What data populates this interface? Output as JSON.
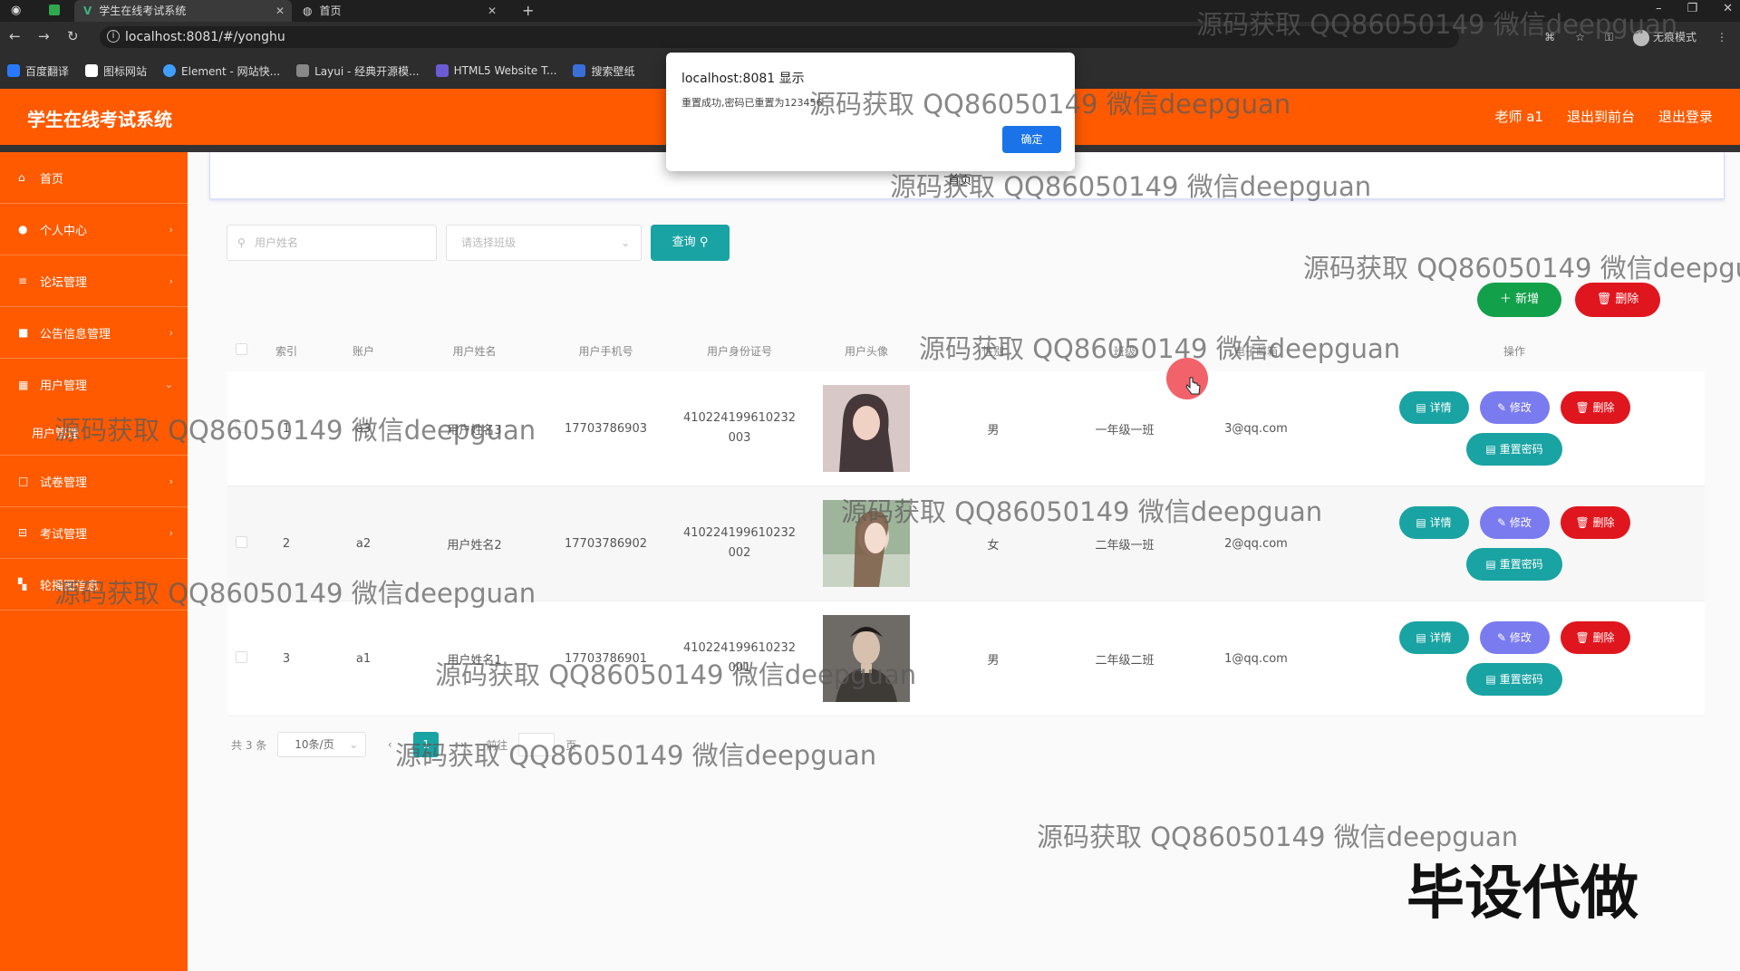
{
  "browser": {
    "tabs": [
      {
        "title": "学生在线考试系统"
      },
      {
        "title": "首页"
      }
    ],
    "url": "localhost:8081/#/yonghu",
    "incognito": "无痕模式",
    "bookmarks": [
      "百度翻译",
      "图标网站",
      "Element - 网站快...",
      "Layui - 经典开源模...",
      "HTML5 Website T...",
      "搜索壁纸"
    ]
  },
  "header": {
    "title": "学生在线考试系统",
    "links": [
      "老师 a1",
      "退出到前台",
      "退出登录"
    ]
  },
  "sidebar": {
    "items": [
      {
        "label": "首页",
        "icon": "home-icon"
      },
      {
        "label": "个人中心",
        "icon": "user-icon"
      },
      {
        "label": "论坛管理",
        "icon": "list-icon"
      },
      {
        "label": "公告信息管理",
        "icon": "notice-icon"
      },
      {
        "label": "用户管理",
        "icon": "users-icon"
      },
      {
        "label": "用户管理",
        "icon": ""
      },
      {
        "label": "试卷管理",
        "icon": "paper-icon"
      },
      {
        "label": "考试管理",
        "icon": "exam-icon"
      },
      {
        "label": "轮播图信息",
        "icon": "grid-icon"
      }
    ]
  },
  "breadcrumb": "首页",
  "search": {
    "name_placeholder": "用户姓名",
    "class_placeholder": "请选择班级",
    "query_label": "查询"
  },
  "actions": {
    "add": "新增",
    "delete": "删除"
  },
  "table": {
    "columns": [
      "索引",
      "账户",
      "用户姓名",
      "用户手机号",
      "用户身份证号",
      "用户头像",
      "性别",
      "班级",
      "电子邮箱",
      "操作"
    ],
    "rows": [
      {
        "index": "1",
        "account": "a3",
        "name": "用户姓名3",
        "phone": "17703786903",
        "id_a": "410224199610232",
        "id_b": "003",
        "gender": "男",
        "class": "一年级一班",
        "email": "3@qq.com"
      },
      {
        "index": "2",
        "account": "a2",
        "name": "用户姓名2",
        "phone": "17703786902",
        "id_a": "410224199610232",
        "id_b": "002",
        "gender": "女",
        "class": "二年级一班",
        "email": "2@qq.com"
      },
      {
        "index": "3",
        "account": "a1",
        "name": "用户姓名1",
        "phone": "17703786901",
        "id_a": "410224199610232",
        "id_b": "001",
        "gender": "男",
        "class": "二年级二班",
        "email": "1@qq.com"
      }
    ],
    "ops": {
      "detail": "详情",
      "edit": "修改",
      "delete": "删除",
      "reset": "重置密码"
    }
  },
  "pager": {
    "total": "共 3 条",
    "size": "10条/页",
    "prev": "前往",
    "page": "1",
    "suffix": "页"
  },
  "dialog": {
    "title": "localhost:8081 显示",
    "message": "重置成功,密码已重置为123456",
    "ok": "确定"
  },
  "watermark": "源码获取 QQ86050149 微信deepguan",
  "stamp": "毕设代做",
  "colors": {
    "brand": "#ff5a00",
    "teal": "#1aa3a3",
    "danger": "#e0161e",
    "success": "#13a04a",
    "purple": "#7b7bf0"
  }
}
